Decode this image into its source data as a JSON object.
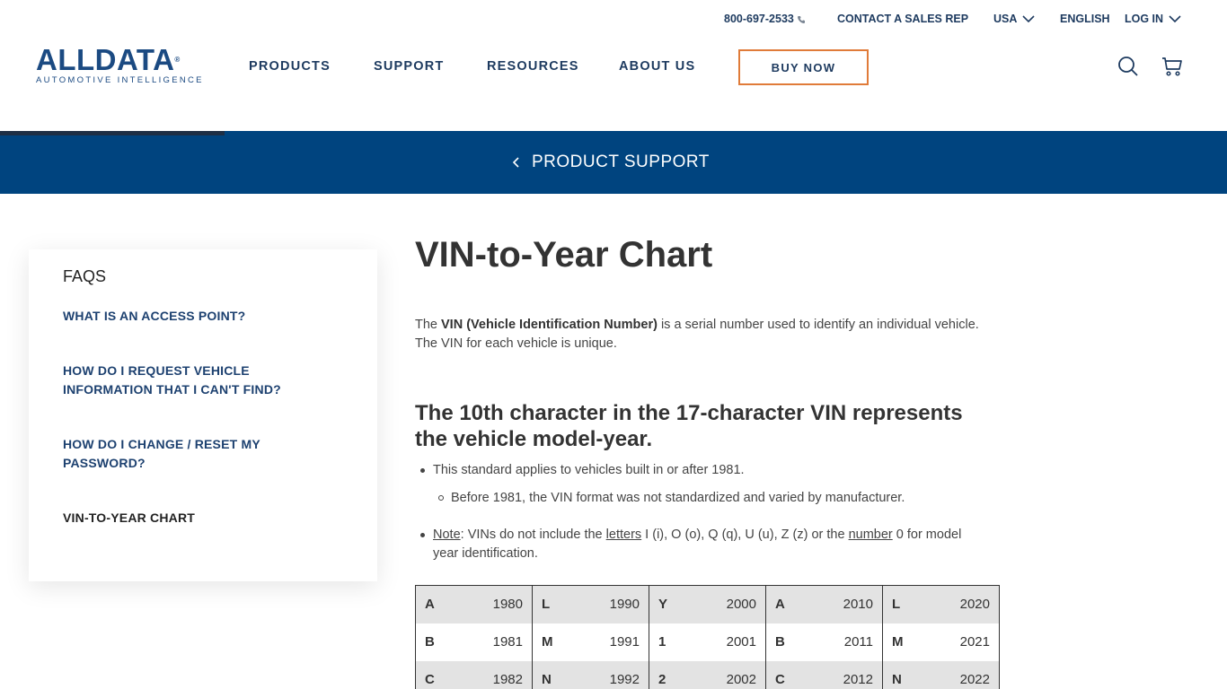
{
  "utility": {
    "phone": "800-697-2533",
    "contact": "CONTACT A SALES REP",
    "country": "USA",
    "language": "ENGLISH",
    "login": "LOG IN"
  },
  "logo": {
    "wordmark": "ALLDATA",
    "tagline": "AUTOMOTIVE INTELLIGENCE"
  },
  "nav": {
    "products": "PRODUCTS",
    "support": "SUPPORT",
    "resources": "RESOURCES",
    "about": "ABOUT US",
    "buy": "BUY NOW"
  },
  "banner": {
    "breadcrumb": "PRODUCT SUPPORT"
  },
  "sidebar": {
    "title": "FAQS",
    "items": [
      "WHAT IS AN ACCESS POINT?",
      "HOW DO I REQUEST VEHICLE INFORMATION THAT I CAN'T FIND?",
      "HOW DO I CHANGE / RESET MY PASSWORD?",
      "VIN-TO-YEAR CHART"
    ]
  },
  "main": {
    "title": "VIN-to-Year Chart",
    "intro_pre": "The ",
    "intro_bold": "VIN (Vehicle Identification Number)",
    "intro_post": " is a serial number used to identify an individual vehicle.  The VIN for each vehicle is unique.",
    "subtitle": "The 10th character in the 17-character VIN represents the vehicle model-year.",
    "bullet1": "This standard applies to vehicles built in or after 1981.",
    "sub_bullet": "Before 1981, the VIN format was not standardized and varied by manufacturer.",
    "note": {
      "label": "Note",
      "t1": ": VINs do not include the ",
      "letters": "letters",
      "t2": " I (i), O (o), Q (q), U (u), Z (z) or the ",
      "number": "number",
      "t3": " 0 for model",
      "line2": "year identification."
    }
  },
  "table": {
    "rows": [
      [
        [
          "A",
          "1980"
        ],
        [
          "L",
          "1990"
        ],
        [
          "Y",
          "2000"
        ],
        [
          "A",
          "2010"
        ],
        [
          "L",
          "2020"
        ]
      ],
      [
        [
          "B",
          "1981"
        ],
        [
          "M",
          "1991"
        ],
        [
          "1",
          "2001"
        ],
        [
          "B",
          "2011"
        ],
        [
          "M",
          "2021"
        ]
      ],
      [
        [
          "C",
          "1982"
        ],
        [
          "N",
          "1992"
        ],
        [
          "2",
          "2002"
        ],
        [
          "C",
          "2012"
        ],
        [
          "N",
          "2022"
        ]
      ]
    ]
  },
  "colors": {
    "brand_blue": "#1b4a82",
    "banner_blue": "#00447f",
    "accent_orange": "#e07b39"
  }
}
